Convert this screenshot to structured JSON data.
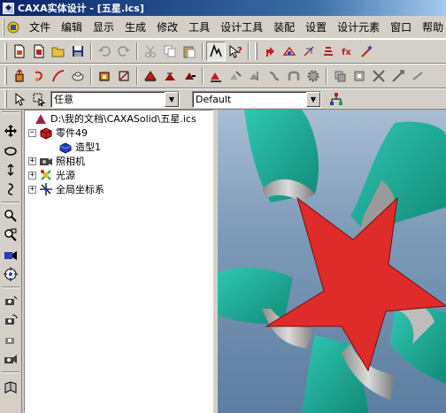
{
  "window": {
    "title": "CAXA实体设计 - [五星.ics]"
  },
  "menu": {
    "items": [
      "文件",
      "编辑",
      "显示",
      "生成",
      "修改",
      "工具",
      "设计工具",
      "装配",
      "设置",
      "设计元素",
      "窗口",
      "帮助"
    ]
  },
  "filter_bar": {
    "selection_filter": "任意",
    "style_value": "Default"
  },
  "tree": {
    "root": "D:\\我的文档\\CAXASolid\\五星.ics",
    "part": "零件49",
    "shape": "造型1",
    "camera": "照相机",
    "light": "光源",
    "coords": "全局坐标系"
  },
  "colors": {
    "star_red": "#e02b2b",
    "teal": "#19a893",
    "titlebar": "#0a246a"
  }
}
